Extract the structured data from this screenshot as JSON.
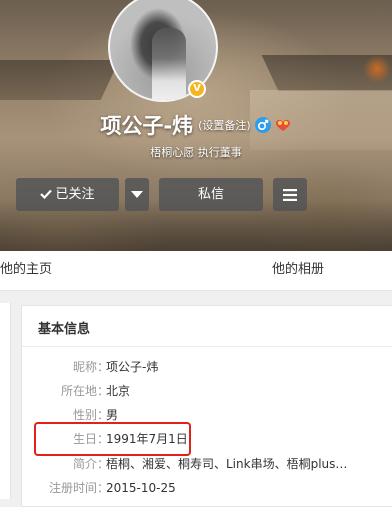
{
  "profile": {
    "name": "项公子-炜",
    "remark_label": "(设置备注)",
    "verify_text": "梧桐心愿 执行董事",
    "verified_badge": "V"
  },
  "actions": {
    "follow_label": "已关注",
    "message_label": "私信"
  },
  "tabs": [
    {
      "label": "他的主页"
    },
    {
      "label": "他的相册"
    }
  ],
  "info_card": {
    "title": "基本信息",
    "rows": [
      {
        "label": "昵称",
        "sep": "：",
        "value": "项公子-炜"
      },
      {
        "label": "所在地",
        "sep": "：",
        "value": "北京"
      },
      {
        "label": "性别",
        "sep": "：",
        "value": "男"
      },
      {
        "label": "生日",
        "sep": "：",
        "value": "1991年7月1日"
      },
      {
        "label": "简介",
        "sep": "：",
        "value": "梧桐、湘爱、桐寿司、Link串场、梧桐plus…"
      },
      {
        "label": "注册时间",
        "sep": "：",
        "value": "2015-10-25"
      }
    ]
  },
  "colors": {
    "highlight": "#e0221b",
    "male": "#2f9ee9",
    "verified": "#f6b51e"
  },
  "icons": [
    "check-icon",
    "chevron-down-icon",
    "menu-icon",
    "male-icon",
    "verified-icon",
    "badge-icon"
  ]
}
